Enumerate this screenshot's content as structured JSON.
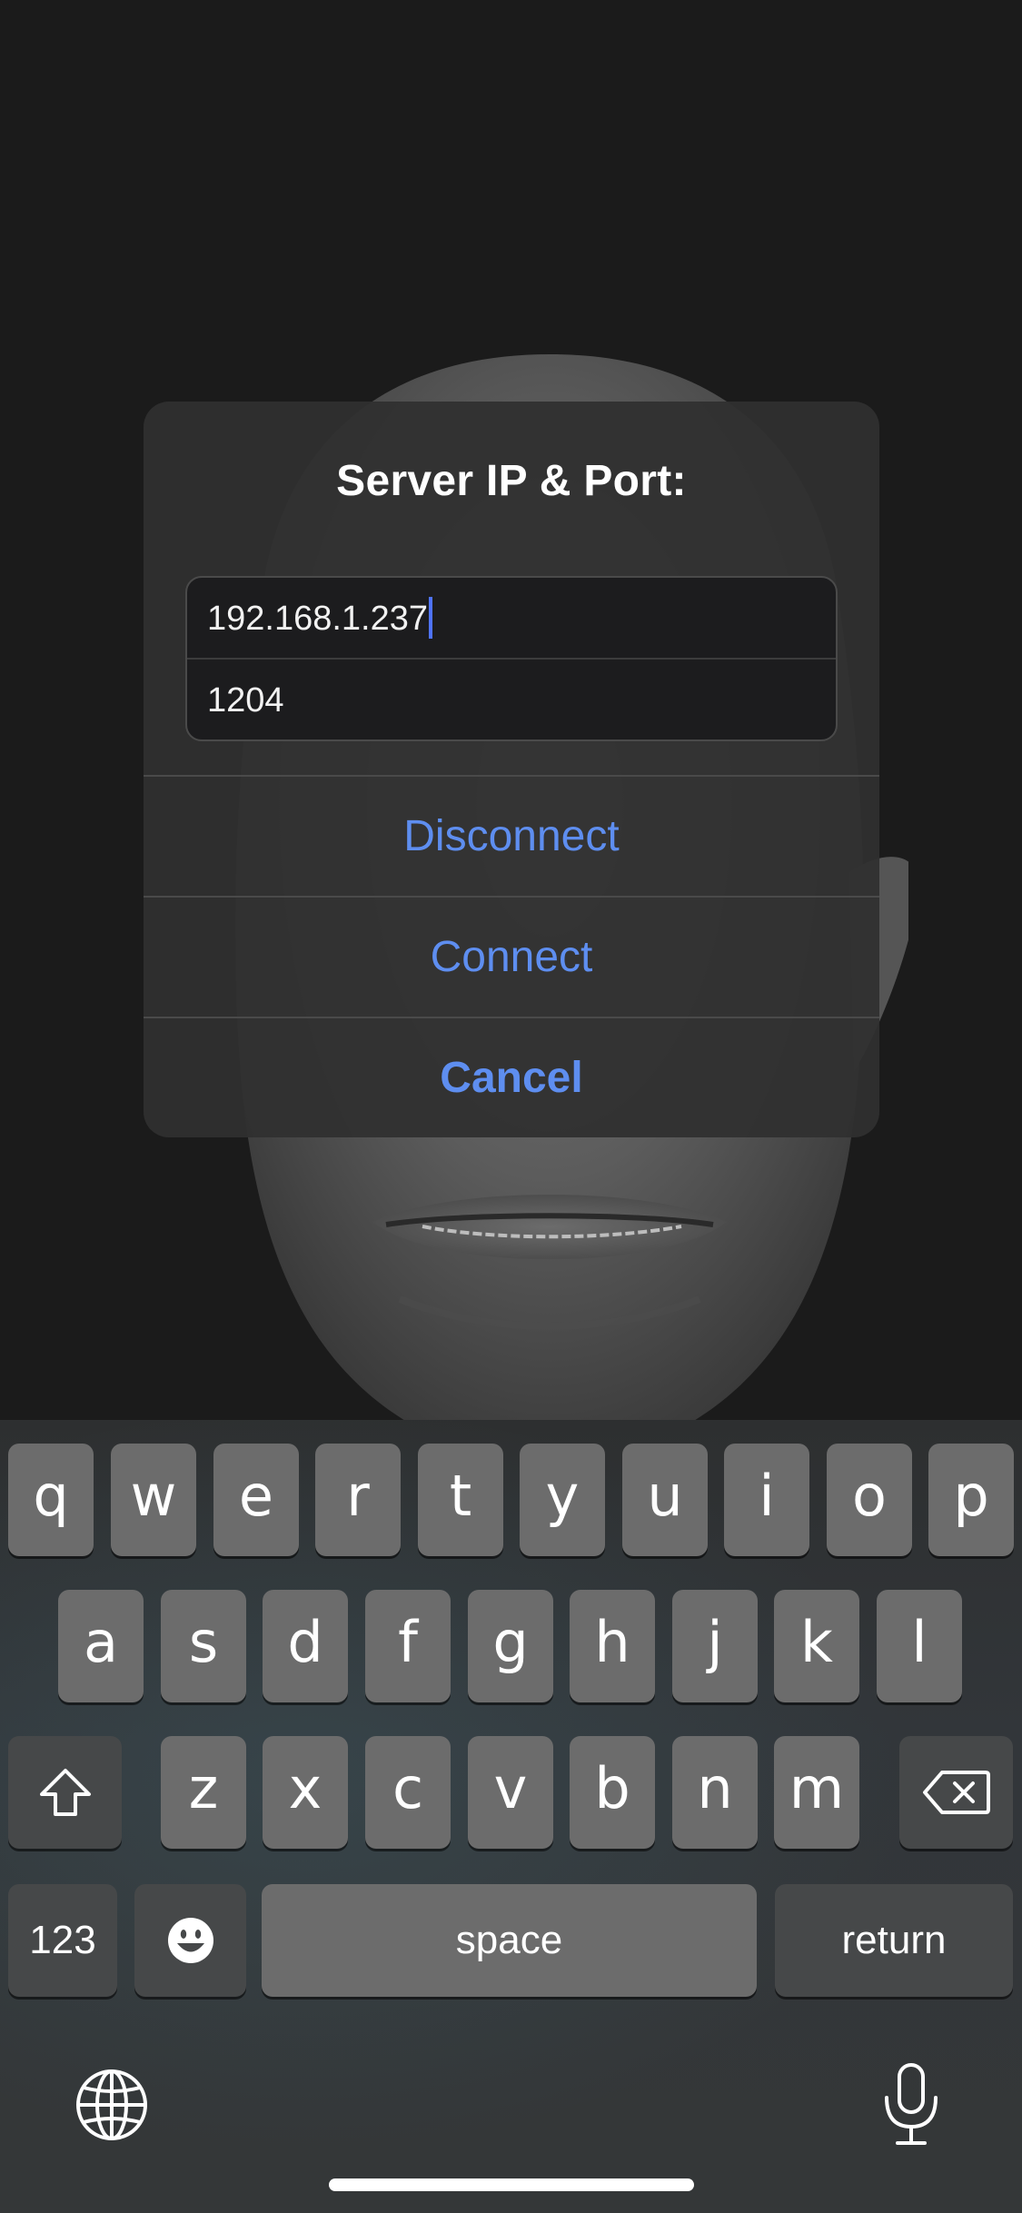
{
  "alert": {
    "title": "Server IP & Port:",
    "ip_value": "192.168.1.237",
    "port_value": "1204",
    "buttons": {
      "disconnect": "Disconnect",
      "connect": "Connect",
      "cancel": "Cancel"
    },
    "accent_color": "#5e8ef0"
  },
  "keyboard": {
    "row1": [
      "q",
      "w",
      "e",
      "r",
      "t",
      "y",
      "u",
      "i",
      "o",
      "p"
    ],
    "row2": [
      "a",
      "s",
      "d",
      "f",
      "g",
      "h",
      "j",
      "k",
      "l"
    ],
    "row3": [
      "z",
      "x",
      "c",
      "v",
      "b",
      "n",
      "m"
    ],
    "numbers_label": "123",
    "space_label": "space",
    "return_label": "return",
    "icons": [
      "shift-icon",
      "backspace-icon",
      "emoji-icon",
      "globe-icon",
      "microphone-icon"
    ]
  }
}
